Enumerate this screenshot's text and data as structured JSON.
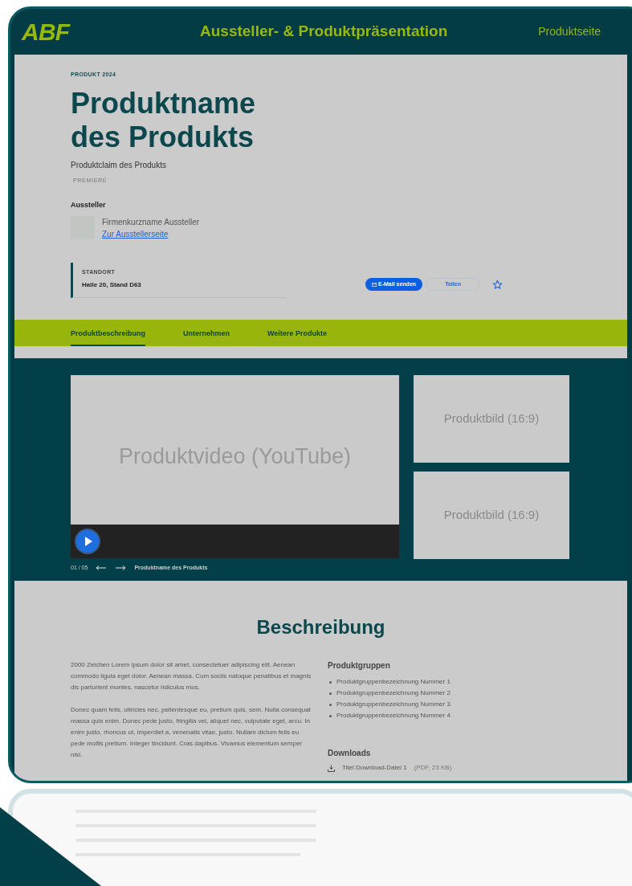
{
  "header": {
    "logo": "ABF",
    "title": "Aussteller- & Produktpräsentation",
    "nav_link": "Produktseite"
  },
  "product": {
    "eyebrow": "PRODUKT 2024",
    "name_lines": [
      "Produktname",
      "des Produkts"
    ],
    "claim": "Produktclaim des Produkts",
    "badge": "PREMIERE"
  },
  "exhibitor": {
    "label": "Aussteller",
    "name": "Firmenkurzname Aussteller",
    "link": "Zur Ausstellerseite"
  },
  "location": {
    "label": "STANDORT",
    "value": "Halle 20, Stand D63"
  },
  "actions": [
    {
      "kind": "primary",
      "label": "E-Mail senden"
    },
    {
      "kind": "outline",
      "label": "Teilen"
    },
    {
      "kind": "star"
    }
  ],
  "tabs": [
    {
      "label": "Produktbeschreibung",
      "selected": true
    },
    {
      "label": "Unternehmen",
      "selected": false
    },
    {
      "label": "Weitere Produkte",
      "selected": false
    }
  ],
  "gallery": {
    "video": "Produktvideo (YouTube)",
    "images": [
      "Produktbild (16:9)",
      "Produktbild (16:9)"
    ],
    "counter": "01 / 05",
    "caption": "Produktname des Produkts"
  },
  "description": {
    "heading": "Beschreibung",
    "paragraphs": [
      "2000 Zeichen Lorem ipsum dolor sit amet, consectetuer adipiscing elit. Aenean commodo ligula eget dolor. Aenean massa. Cum sociis natoque penatibus et magnis dis parturient montes, nascetur ridiculus mus.",
      "Donec quam felis, ultricies nec, pellentesque eu, pretium quis, sem. Nulla consequat massa quis enim. Donec pede justo, fringilla vel, aliquet nec, vulputate eget, arcu. In enim justo, rhoncus ut, imperdiet a, venenatis vitae, justo. Nullam dictum felis eu pede mollis pretium. Integer tincidunt. Cras dapibus. Vivamus elementum semper nisi."
    ],
    "groups_heading": "Produktgruppen",
    "groups": [
      "Produktgruppenbezeichnung Nummer 1",
      "Produktgruppenbezeichnung Nummer 2",
      "Produktgruppenbezeichnung Nummer 3",
      "Produktgruppenbezeichnung Nummer 4"
    ],
    "downloads_heading": "Downloads",
    "downloads": [
      {
        "title": "Titel Download-Datei 1",
        "meta": "(PDF, 23 KB)"
      }
    ]
  }
}
